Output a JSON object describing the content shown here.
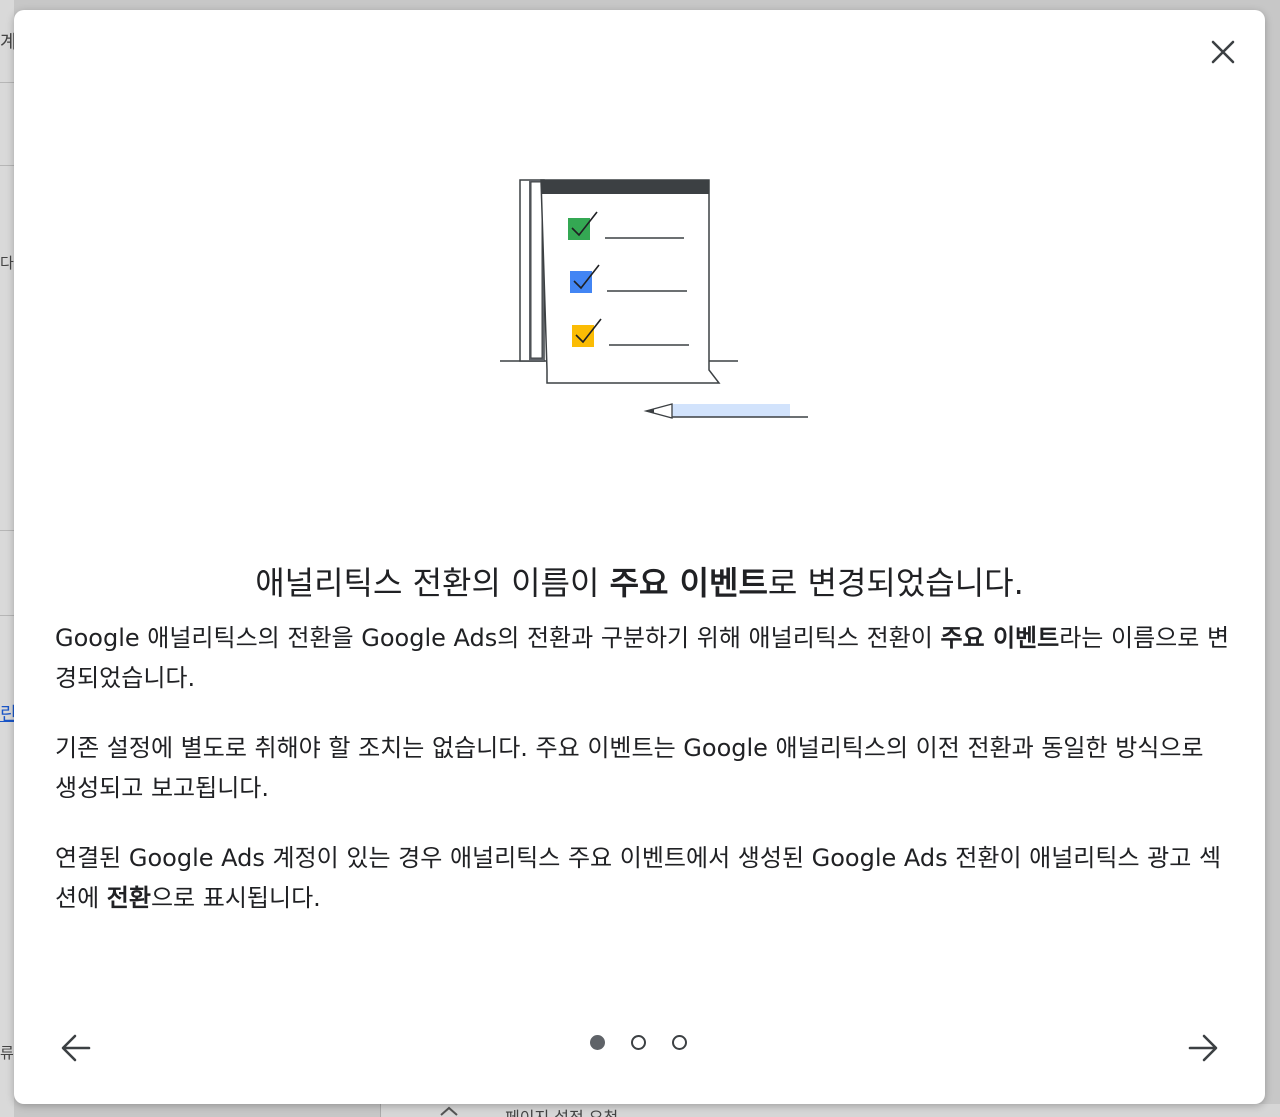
{
  "background": {
    "left_fragments": [
      "계",
      "다",
      "린",
      "류"
    ],
    "bottom_text": "페이지 설정 요청"
  },
  "dialog": {
    "close_label": "×",
    "title": {
      "before": "애널리틱스 전환의 이름이 ",
      "bold": "주요 이벤트",
      "after": "로 변경되었습니다."
    },
    "paragraphs": [
      {
        "before": "Google 애널리틱스의 전환을 Google Ads의 전환과 구분하기 위해 애널리틱스 전환이 ",
        "bold": "주요 이벤트",
        "after": "라는 이름으로 변경되었습니다."
      },
      {
        "before": "기존 설정에 별도로 취해야 할 조치는 없습니다. 주요 이벤트는 Google 애널리틱스의 이전 전환과 동일한 방식으로 생성되고 보고됩니다.",
        "bold": "",
        "after": ""
      },
      {
        "before": "연결된 Google Ads 계정이 있는 경우 애널리틱스 주요 이벤트에서 생성된 Google Ads 전환이 애널리틱스 광고 섹션에 ",
        "bold": "전환",
        "after": "으로 표시됩니다."
      }
    ],
    "pagination": {
      "total": 3,
      "current": 1
    },
    "icons": {
      "close": "close-icon",
      "prev": "arrow-left-icon",
      "next": "arrow-right-icon"
    },
    "illustration_colors": {
      "check_green": "#34a853",
      "check_blue": "#4285f4",
      "check_yellow": "#fbbc04",
      "pencil": "#d2e3fc"
    }
  }
}
